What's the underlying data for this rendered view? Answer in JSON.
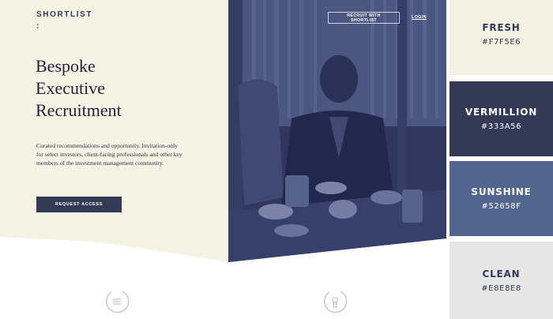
{
  "brand": {
    "logo": "SHORTLIST",
    "logo_mark": ":"
  },
  "hero": {
    "headline_lines": [
      "Bespoke",
      "Executive",
      "Recruitment"
    ],
    "intro": "Curated recommendations and opportunity. Invitation-only for select investors, client-facing professionals and other key members of the investment management community.",
    "cta_label": "REQUEST ACCESS"
  },
  "nav": {
    "recruit_label": "RECRUIT WITH SHORTLIST",
    "login_label": "LOGIN"
  },
  "palette": [
    {
      "name": "FRESH",
      "hex": "#F7F5E6",
      "bg": "#f4f2e3",
      "fg": "#333a56"
    },
    {
      "name": "VERMILLION",
      "hex": "#333A56",
      "bg": "#333a56",
      "fg": "#ffffff"
    },
    {
      "name": "SUNSHINE",
      "hex": "#52658F",
      "bg": "#52658f",
      "fg": "#ffffff"
    },
    {
      "name": "CLEAN",
      "hex": "#E8E8E8",
      "bg": "#e6e6e6",
      "fg": "#333a56"
    }
  ],
  "icons": {
    "menu": "menu-icon",
    "lock": "lock-icon"
  }
}
